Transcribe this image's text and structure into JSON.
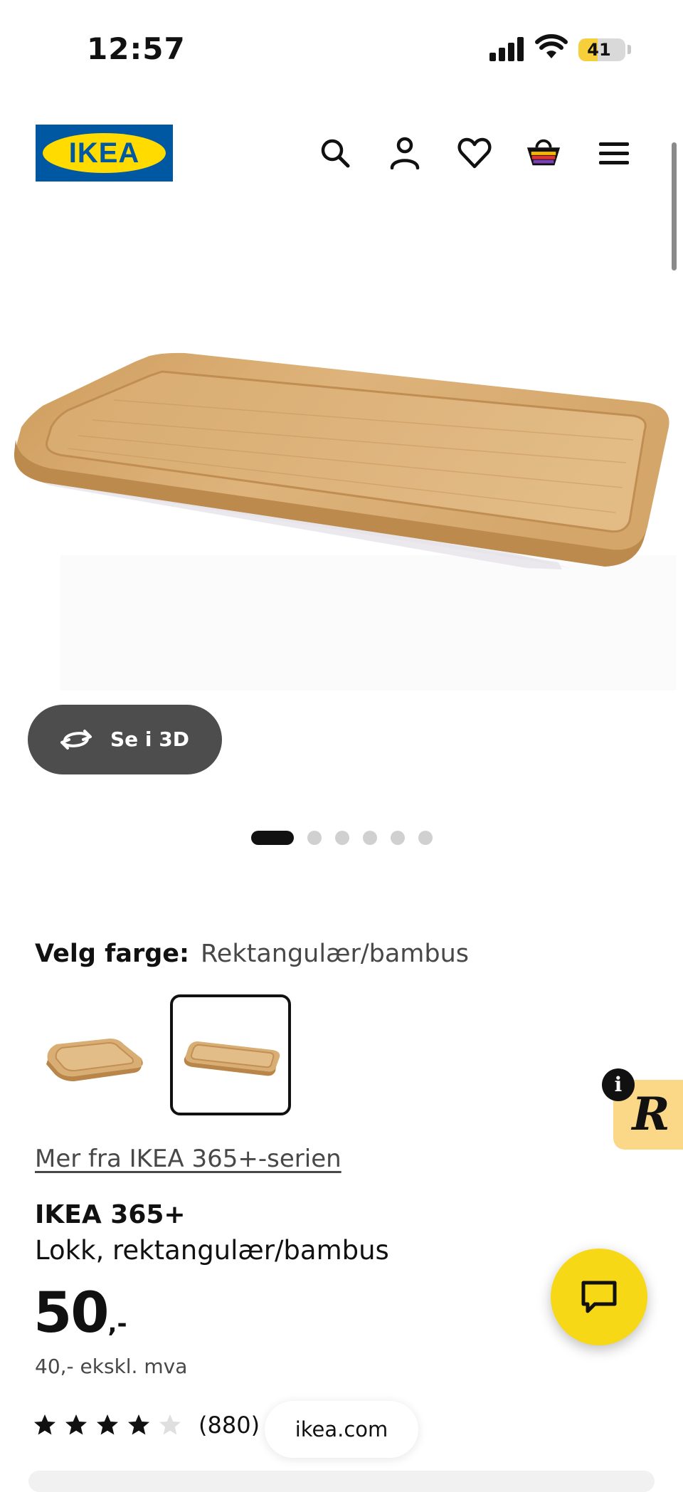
{
  "status_bar": {
    "time": "12:57",
    "battery": "41",
    "battery_level": 0.41
  },
  "header": {
    "logo_text": "IKEA",
    "icons": [
      "search-icon",
      "user-icon",
      "heart-icon",
      "basket-icon",
      "menu-icon"
    ]
  },
  "gallery": {
    "view3d_label": "Se i 3D",
    "image_count": 6,
    "active_index": 1
  },
  "color_selector": {
    "label": "Velg farge:",
    "value": "Rektangulær/bambus",
    "variants": [
      "square-bamboo-lid",
      "rectangular-bamboo-lid"
    ],
    "selected_index": 2
  },
  "product": {
    "series_link": "Mer fra IKEA 365+-serien",
    "name": "IKEA 365+",
    "description": "Lokk, rektangulær/bambus",
    "price_int": "50",
    "price_dec": ",-",
    "price_ex_vat": "40,- ekskl. mva",
    "rating": 4,
    "rating_max": 5,
    "review_count": "(880)"
  },
  "browser": {
    "url": "ikea.com"
  },
  "overlays": {
    "rakuten_letter": "R",
    "info_letter": "i"
  },
  "colors": {
    "ikea_blue": "#0058a3",
    "ikea_yellow": "#ffdb00",
    "chat_yellow": "#f7d816"
  }
}
